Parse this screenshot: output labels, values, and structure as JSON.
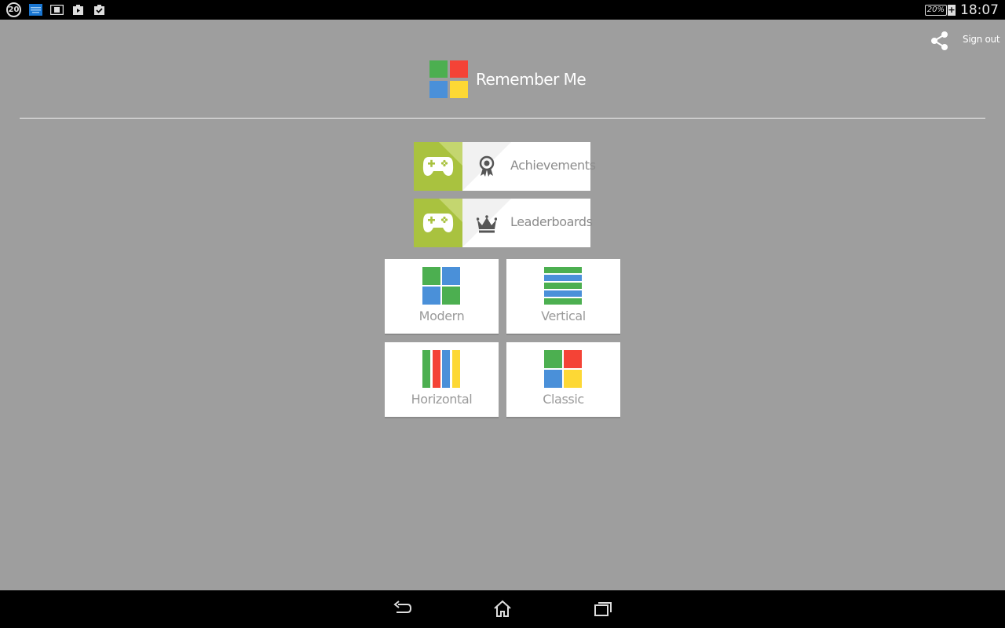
{
  "status_bar": {
    "notification_count": "20",
    "time": "18:07",
    "battery": "20%",
    "battery_charging_symbol": "+",
    "icons": [
      "notification-count-icon",
      "keyboard-icon",
      "sim-card-icon",
      "play-store-icon",
      "task-check-icon"
    ]
  },
  "header": {
    "app_title": "Remember Me",
    "sign_out_label": "Sign out",
    "share_icon": "share-icon"
  },
  "play_games": [
    {
      "label": "Achievements",
      "icon": "award-ribbon-icon"
    },
    {
      "label": "Leaderboards",
      "icon": "crown-icon"
    }
  ],
  "layouts": [
    {
      "label": "Modern"
    },
    {
      "label": "Vertical"
    },
    {
      "label": "Horizontal"
    },
    {
      "label": "Classic"
    }
  ],
  "colors": {
    "green": "#4caf50",
    "red": "#f44336",
    "blue": "#4a90d9",
    "yellow": "#fdd835",
    "play_games_green": "#a9c23f",
    "background": "#9e9e9e"
  },
  "nav_bar": [
    "back-icon",
    "home-icon",
    "recents-icon"
  ]
}
